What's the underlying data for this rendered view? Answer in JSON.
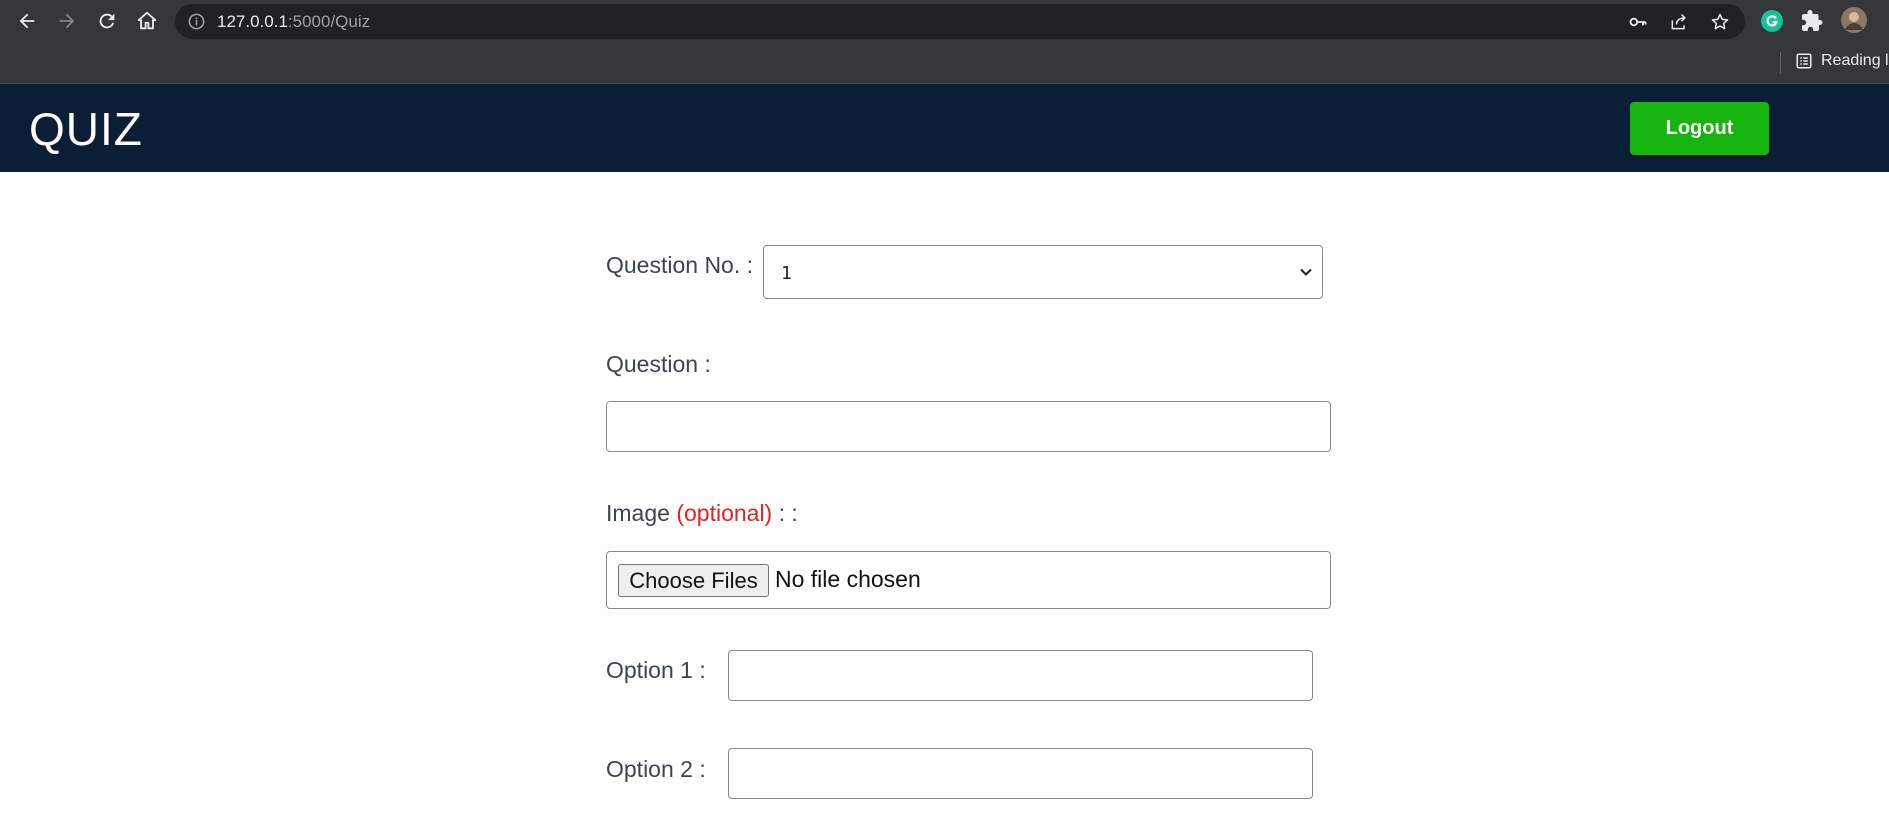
{
  "browser": {
    "url_host": "127.0.0.1",
    "url_rest": ":5000/Quiz",
    "reading_list_label": "Reading li"
  },
  "header": {
    "brand": "QUIZ",
    "logout_label": "Logout"
  },
  "form": {
    "question_no_label": "Question No. :",
    "question_no_value": "1",
    "question_label": "Question :",
    "question_value": "",
    "image_label": "Image",
    "image_optional": "(optional)",
    "image_suffix": ": :",
    "choose_files_label": "Choose Files",
    "no_file_text": "No file chosen",
    "option1_label": "Option 1 :",
    "option1_value": "",
    "option2_label": "Option 2 :",
    "option2_value": ""
  },
  "colors": {
    "header_bg": "#0a1f36",
    "logout_bg": "#16b40e",
    "optional_text": "#e0231f"
  }
}
